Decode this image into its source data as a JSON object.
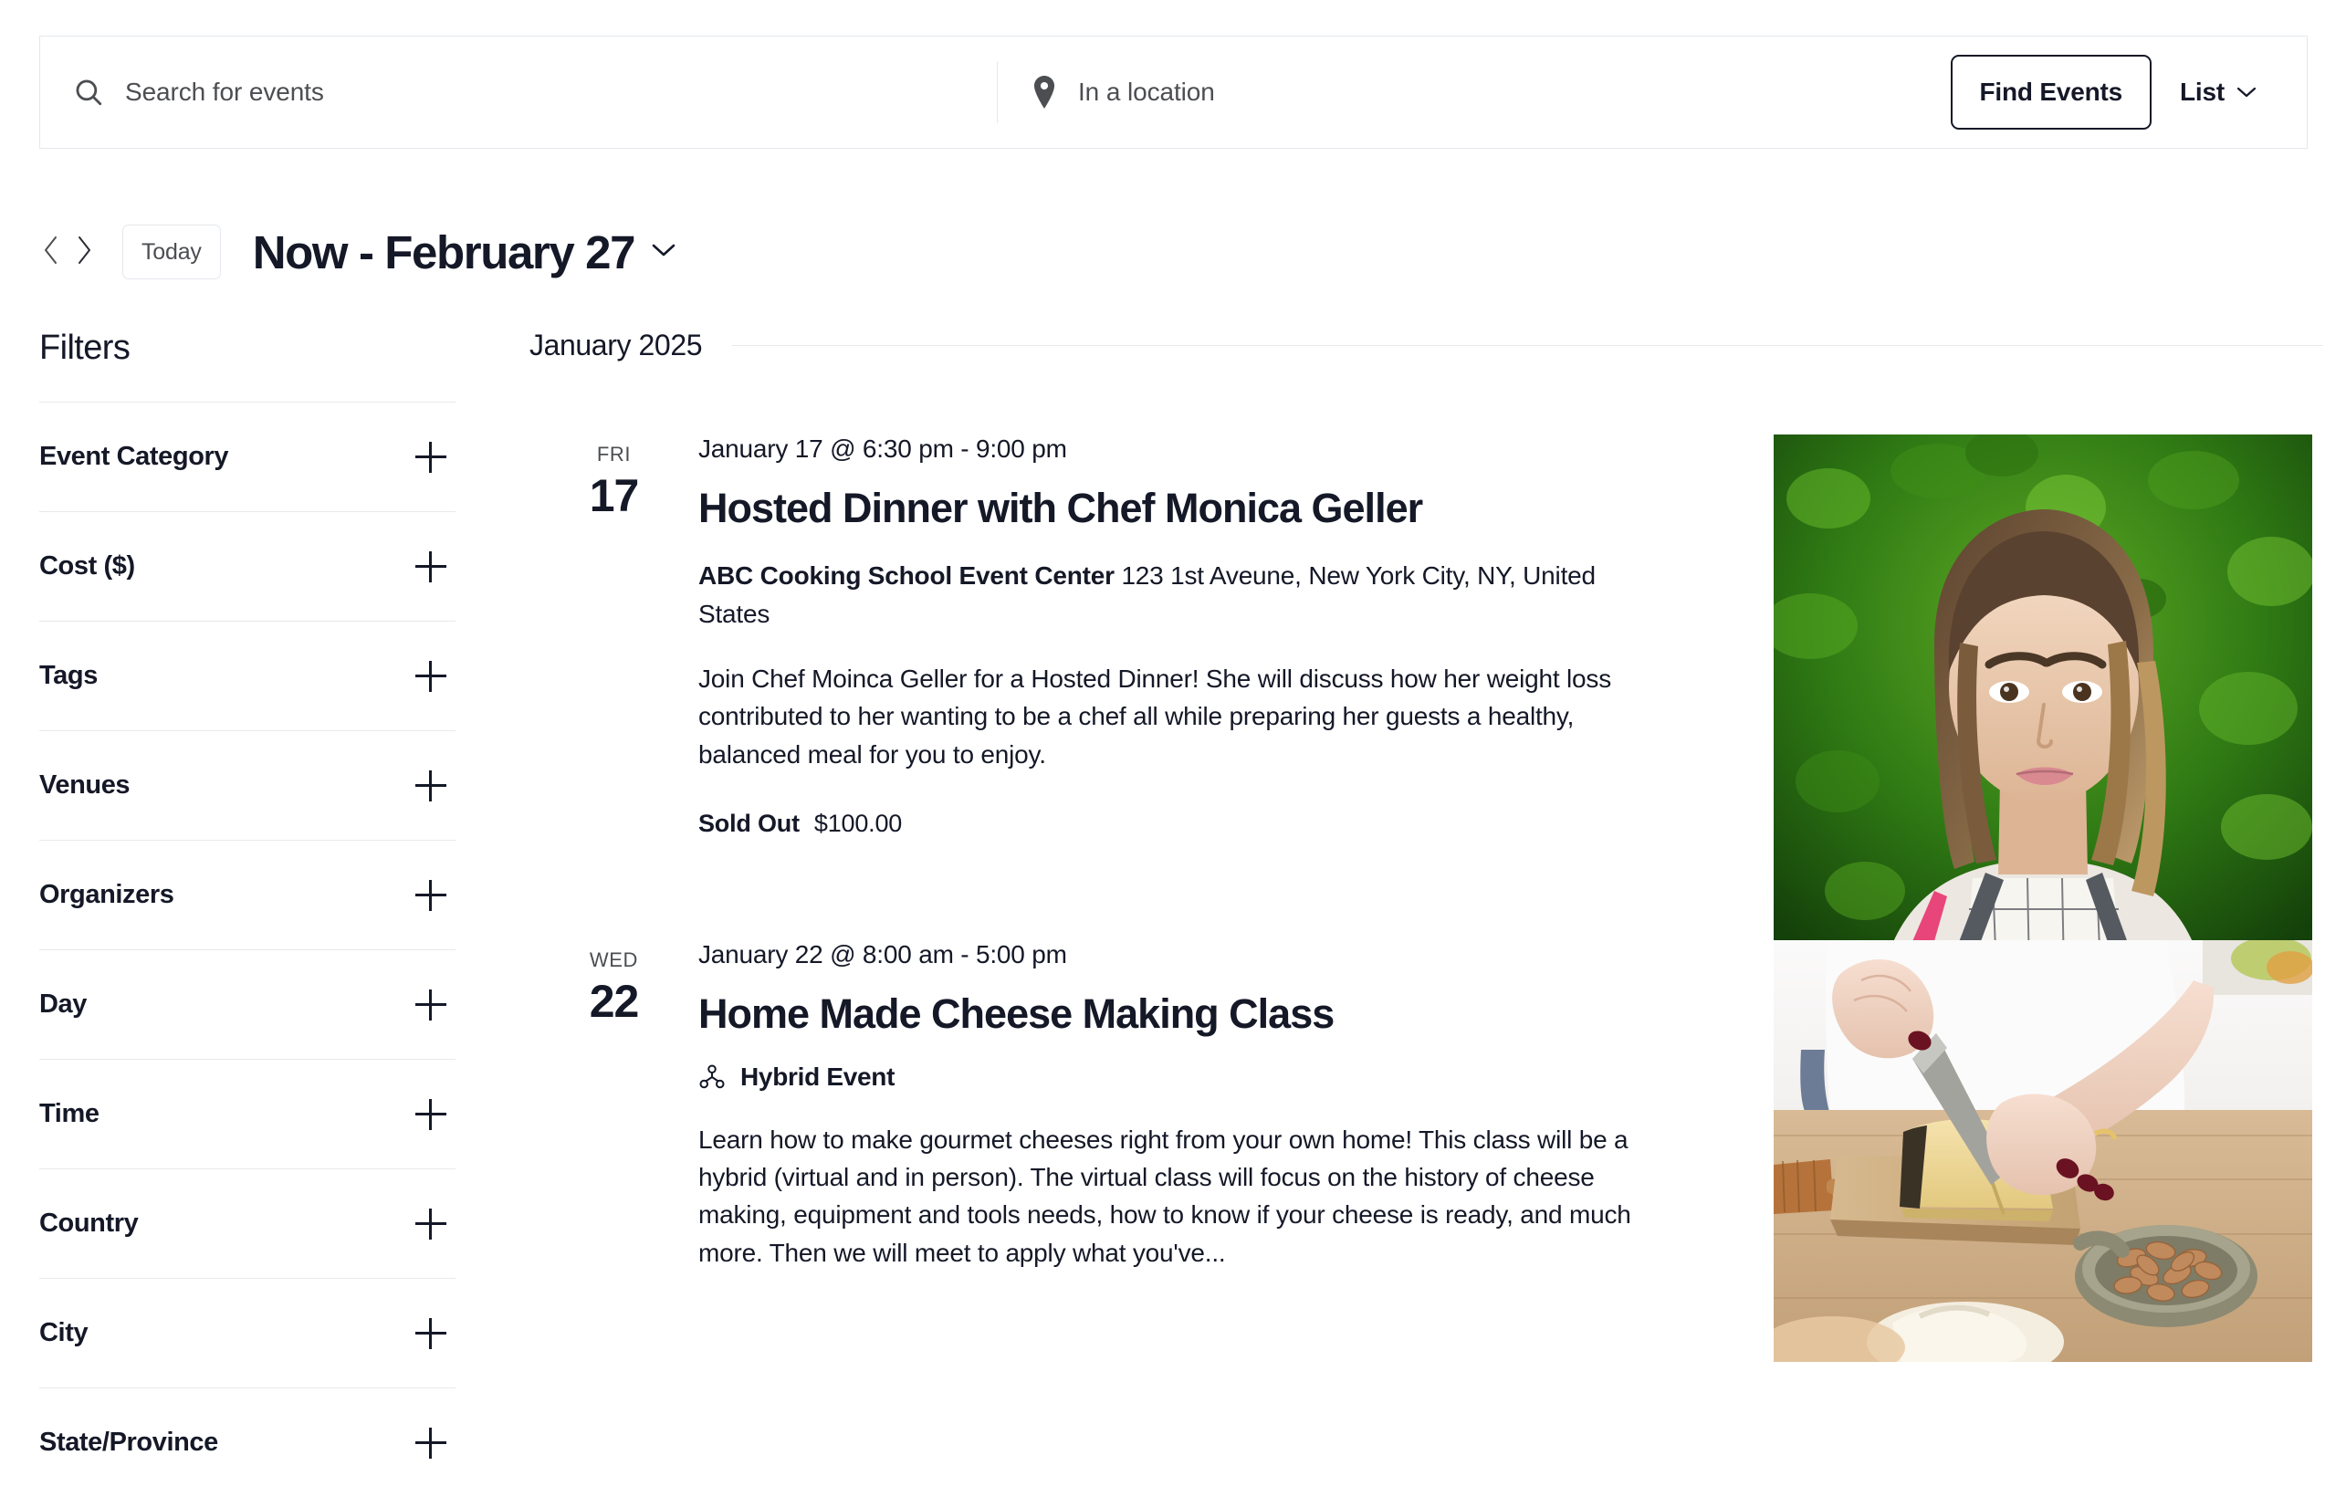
{
  "search": {
    "events_placeholder": "Search for events",
    "location_placeholder": "In a location",
    "search_icon": "search-icon",
    "location_icon": "map-pin-icon",
    "find_events_label": "Find Events",
    "view_label": "List",
    "view_caret_icon": "chevron-down-icon"
  },
  "datebar": {
    "prev_icon": "chevron-left-icon",
    "next_icon": "chevron-right-icon",
    "today_label": "Today",
    "range_title": "Now - February 27",
    "caret_icon": "chevron-down-icon"
  },
  "filters": {
    "title": "Filters",
    "expand_icon": "plus-icon",
    "items": [
      {
        "label": "Event Category"
      },
      {
        "label": "Cost ($)"
      },
      {
        "label": "Tags"
      },
      {
        "label": "Venues"
      },
      {
        "label": "Organizers"
      },
      {
        "label": "Day"
      },
      {
        "label": "Time"
      },
      {
        "label": "Country"
      },
      {
        "label": "City"
      },
      {
        "label": "State/Province"
      }
    ]
  },
  "events": {
    "month_label": "January 2025",
    "list": [
      {
        "dow": "FRI",
        "day": "17",
        "time": "January 17 @ 6:30 pm - 9:00 pm",
        "title": "Hosted Dinner with Chef Monica Geller",
        "venue_name": "ABC Cooking School Event Center",
        "venue_address": "123 1st Aveune, New York City, NY, United States",
        "description": "Join Chef Moinca Geller for a Hosted Dinner! She will discuss how her weight loss contributed to her wanting to be a chef all while preparing her guests a healthy, balanced meal for you to enjoy.",
        "cost_status": "Sold Out",
        "cost_price": "$100.00",
        "thumb_alt": "chef-portrait-photo"
      },
      {
        "dow": "WED",
        "day": "22",
        "time": "January 22 @ 8:00 am - 5:00 pm",
        "title": "Home Made Cheese Making Class",
        "badge_icon": "hybrid-event-icon",
        "badge_label": "Hybrid Event",
        "description": "Learn how to make gourmet cheeses right from your own home! This class will be a hybrid (virtual and in person). The virtual class will focus on the history of cheese making, equipment and tools needs, how to know if your cheese is ready, and much more. Then we will meet to apply what you've...",
        "thumb_alt": "cheese-cutting-photo"
      }
    ]
  },
  "colors": {
    "text": "#141827",
    "muted": "#4c4e52",
    "border": "#e4e8ec",
    "rule": "#e7e9ec",
    "white": "#ffffff"
  }
}
